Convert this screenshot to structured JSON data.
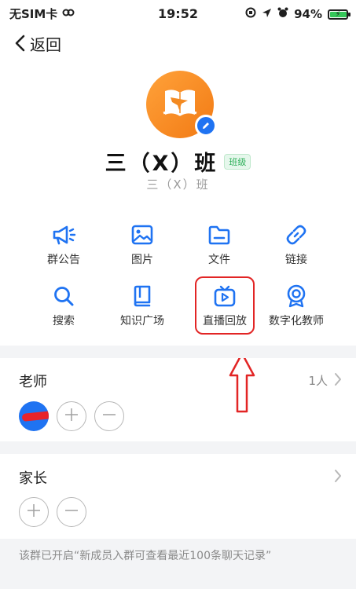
{
  "status_bar": {
    "carrier": "无SIM卡",
    "time": "19:52",
    "battery": "94%",
    "battery_level": 0.94
  },
  "nav": {
    "back_label": "返回"
  },
  "group": {
    "name": "三（X）班",
    "badge": "班级",
    "subtitle": "三（X）班"
  },
  "features": [
    {
      "label": "群公告",
      "icon": "megaphone-icon"
    },
    {
      "label": "图片",
      "icon": "image-icon"
    },
    {
      "label": "文件",
      "icon": "folder-icon"
    },
    {
      "label": "链接",
      "icon": "link-icon"
    },
    {
      "label": "搜索",
      "icon": "search-icon"
    },
    {
      "label": "知识广场",
      "icon": "book-icon"
    },
    {
      "label": "直播回放",
      "icon": "tv-play-icon"
    },
    {
      "label": "数字化教师",
      "icon": "badge-icon"
    }
  ],
  "teachers": {
    "title": "老师",
    "count": "1人"
  },
  "parents": {
    "title": "家长"
  },
  "notice": "该群已开启“新成员入群可查看最近100条聊天记录”",
  "colors": {
    "accent": "#1f73f2",
    "highlight": "#e22525",
    "avatar_gradient": "#f5891f"
  }
}
